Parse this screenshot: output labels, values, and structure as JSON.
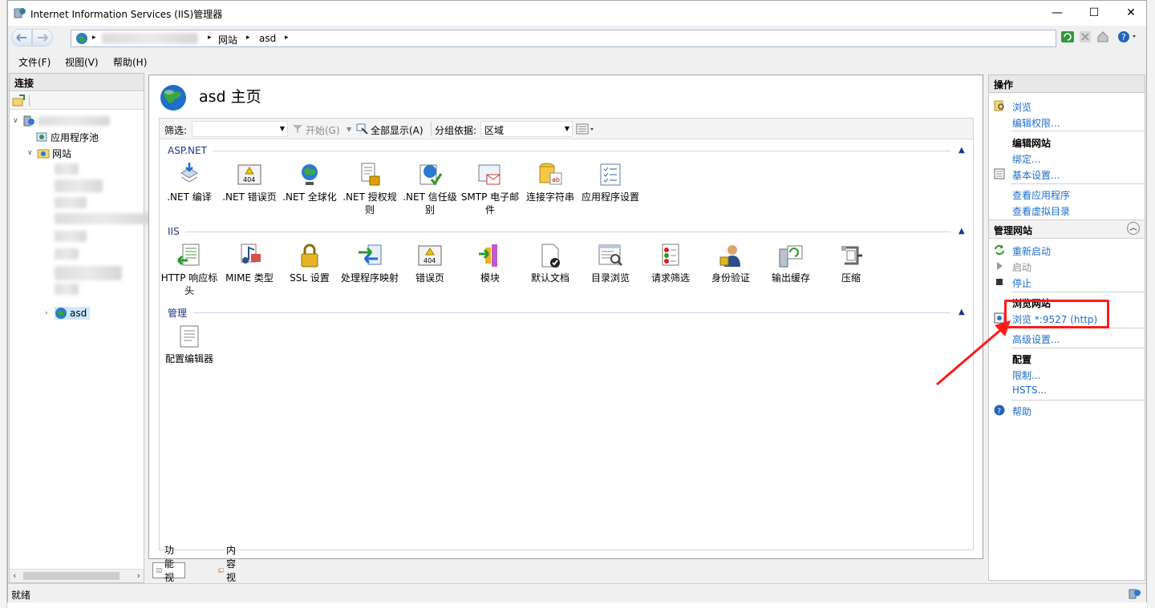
{
  "window": {
    "title": "Internet Information Services (IIS)管理器",
    "controls": {
      "minimize": "—",
      "maximize": "☐",
      "close": "✕"
    }
  },
  "address": {
    "segments": [
      "网站",
      "asd"
    ],
    "separator": "▸"
  },
  "menu": [
    "文件(F)",
    "视图(V)",
    "帮助(H)"
  ],
  "connections": {
    "title": "连接",
    "tree": {
      "app_pools": "应用程序池",
      "sites": "网站",
      "selected_site": "asd"
    }
  },
  "center": {
    "title": "asd 主页",
    "filter": {
      "label": "筛选:",
      "start": "开始(G)",
      "show_all": "全部显示(A)",
      "group_by_label": "分组依据:",
      "group_by_value": "区域"
    },
    "groups": [
      {
        "name": "ASP.NET",
        "items": [
          ".NET 编译",
          ".NET 错误页",
          ".NET 全球化",
          ".NET 授权规则",
          ".NET 信任级别",
          "SMTP 电子邮件",
          "连接字符串",
          "应用程序设置"
        ]
      },
      {
        "name": "IIS",
        "items": [
          "HTTP 响应标头",
          "MIME 类型",
          "SSL 设置",
          "处理程序映射",
          "错误页",
          "模块",
          "默认文档",
          "目录浏览",
          "请求筛选",
          "身份验证",
          "输出缓存",
          "压缩"
        ]
      },
      {
        "name": "管理",
        "items": [
          "配置编辑器"
        ]
      }
    ]
  },
  "bottom_tabs": [
    "功能视图",
    "内容视图"
  ],
  "actions": {
    "title": "操作",
    "browse": "浏览",
    "edit_permissions": "编辑权限...",
    "edit_site": "编辑网站",
    "bindings": "绑定...",
    "basic_settings": "基本设置...",
    "view_apps": "查看应用程序",
    "view_vdirs": "查看虚拟目录",
    "manage_site": "管理网站",
    "restart": "重新启动",
    "start": "启动",
    "stop": "停止",
    "browse_site": "浏览网站",
    "browse_http": "浏览 *:9527 (http)",
    "advanced_settings": "高级设置...",
    "config": "配置",
    "limits": "限制...",
    "hsts": "HSTS...",
    "help": "帮助"
  },
  "status": {
    "text": "就绪"
  },
  "colors": {
    "link": "#1e6ec7",
    "group_header": "#1e3287",
    "annotation": "#ff1a1a",
    "selection": "#cce8ff"
  }
}
